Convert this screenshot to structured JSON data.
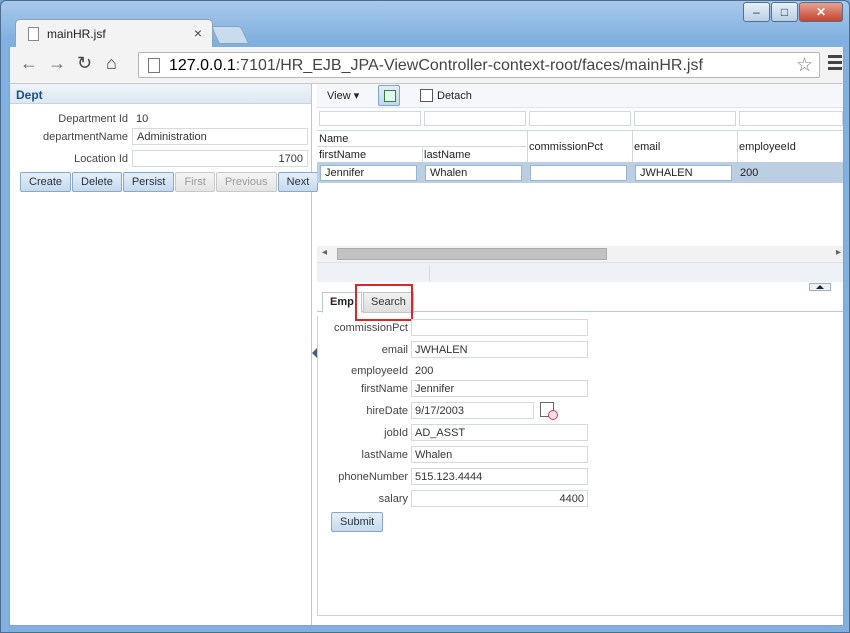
{
  "browser": {
    "tab_title": "mainHR.jsf",
    "url_host": "127.0.0.1",
    "url_rest": ":7101/HR_EJB_JPA-ViewController-context-root/faces/mainHR.jsf",
    "icons": [
      "page-icon",
      "close-icon",
      "back-icon",
      "forward-icon",
      "reload-icon",
      "home-icon",
      "star-icon",
      "menu-icon"
    ]
  },
  "dept": {
    "header": "Dept",
    "fields": {
      "department_id_label": "Department Id",
      "department_id_value": "10",
      "department_name_label": "departmentName",
      "department_name_value": "Administration",
      "location_id_label": "Location Id",
      "location_id_value": "1700"
    },
    "buttons": {
      "create": "Create",
      "delete": "Delete",
      "persist": "Persist",
      "first": "First",
      "previous": "Previous",
      "next": "Next"
    }
  },
  "emp_table": {
    "toolbar": {
      "view": "View ▾",
      "detach": "Detach"
    },
    "group_header": "Name",
    "columns": [
      "firstName",
      "lastName",
      "commissionPct",
      "email",
      "employeeId"
    ],
    "row": {
      "firstName": "Jennifer",
      "lastName": "Whalen",
      "commissionPct": "",
      "email": "JWHALEN",
      "employeeId": "200"
    }
  },
  "emp_form": {
    "tabs": [
      "Emp",
      "Search"
    ],
    "active_tab": "Emp",
    "fields": {
      "commissionPct": {
        "label": "commissionPct",
        "value": ""
      },
      "email": {
        "label": "email",
        "value": "JWHALEN"
      },
      "employeeId": {
        "label": "employeeId",
        "value": "200"
      },
      "firstName": {
        "label": "firstName",
        "value": "Jennifer"
      },
      "hireDate": {
        "label": "hireDate",
        "value": "9/17/2003"
      },
      "jobId": {
        "label": "jobId",
        "value": "AD_ASST"
      },
      "lastName": {
        "label": "lastName",
        "value": "Whalen"
      },
      "phoneNumber": {
        "label": "phoneNumber",
        "value": "515.123.4444"
      },
      "salary": {
        "label": "salary",
        "value": "4400"
      }
    },
    "submit": "Submit"
  },
  "colors": {
    "accent": "#1a4f8c",
    "highlight": "#e0222a",
    "selected_row": "#bccee2"
  }
}
